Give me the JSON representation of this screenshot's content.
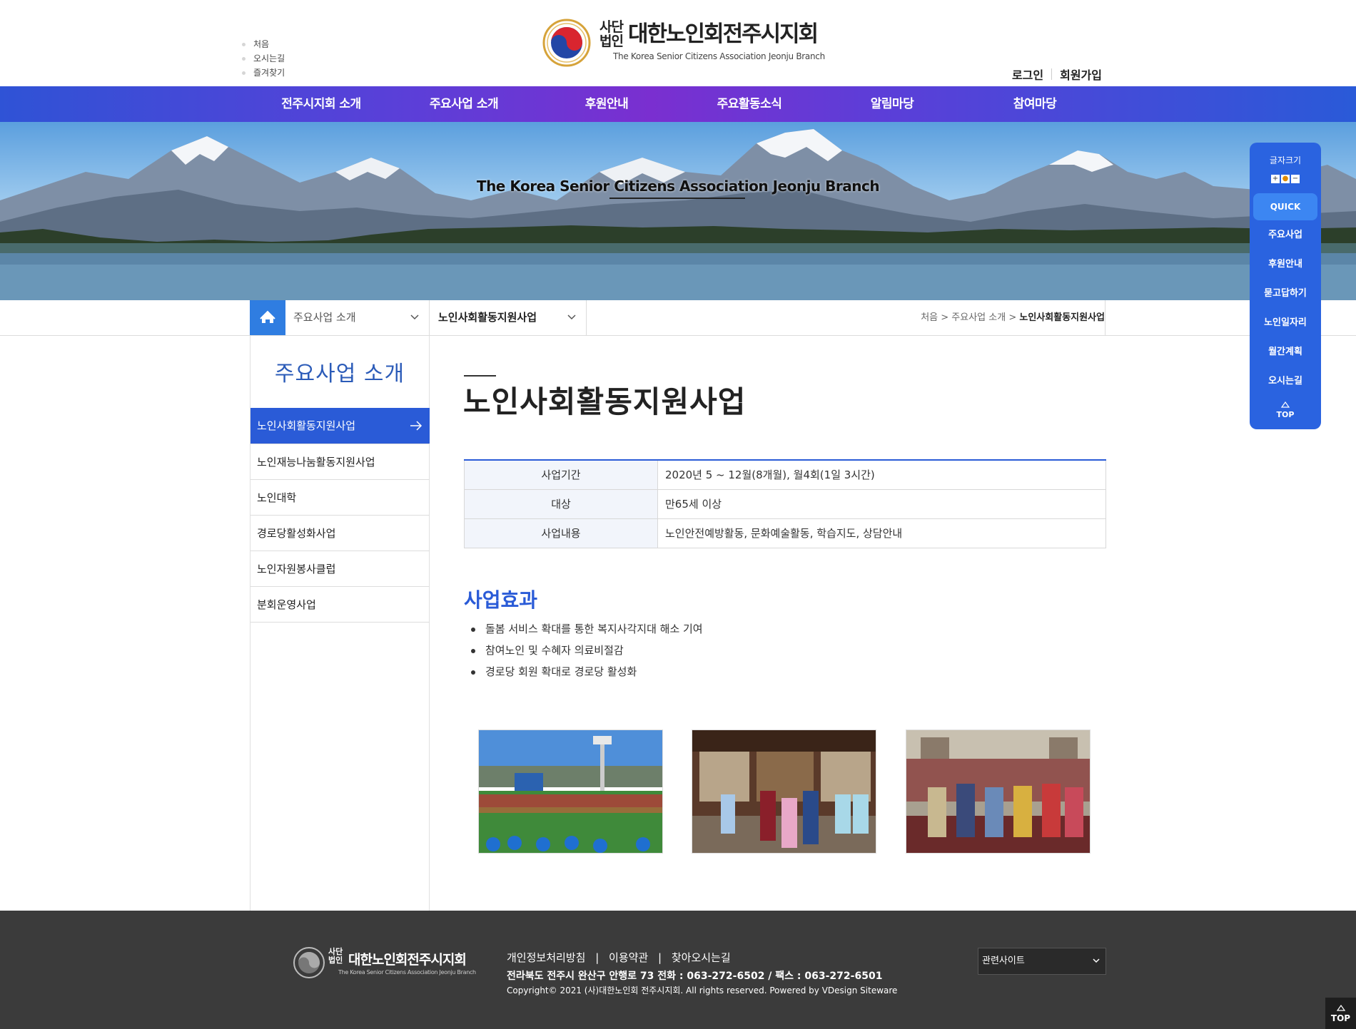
{
  "util_links": [
    "처음",
    "오시는길",
    "즐겨찾기"
  ],
  "logo": {
    "corp_line1": "사단",
    "corp_line2": "법인",
    "name": "대한노인회전주시지회",
    "english": "The Korea Senior Citizens Association Jeonju Branch"
  },
  "member": {
    "login": "로그인",
    "join": "회원가입"
  },
  "gnb": [
    "전주시지회 소개",
    "주요사업 소개",
    "후원안내",
    "주요활동소식",
    "알림마당",
    "참여마당"
  ],
  "visual": {
    "title": "The Korea Senior Citizens Association Jeonju Branch"
  },
  "location": {
    "dropdown1": "주요사업 소개",
    "dropdown2": "노인사회활동지원사업",
    "crumb_home": "처음",
    "crumb_sep": ">",
    "crumb_mid": "주요사업 소개",
    "crumb_current": "노인사회활동지원사업"
  },
  "side": {
    "title": "주요사업 소개",
    "items": [
      "노인사회활동지원사업",
      "노인재능나눔활동지원사업",
      "노인대학",
      "경로당활성화사업",
      "노인자원봉사클럽",
      "분회운영사업"
    ]
  },
  "page": {
    "title": "노인사회활동지원사업"
  },
  "info_table": [
    {
      "label": "사업기간",
      "value": "2020년 5 ~ 12월(8개월), 월4회(1일 3시간)"
    },
    {
      "label": "대상",
      "value": "만65세 이상"
    },
    {
      "label": "사업내용",
      "value": "노인안전예방활동, 문화예술활동, 학습지도, 상담안내"
    }
  ],
  "effects": {
    "title": "사업효과",
    "items": [
      "돌봄 서비스 확대를 통한 복지사각지대 해소 기여",
      "참여노인 및 수혜자 의료비절감",
      "경로당 회원 확대로 경로당 활성화"
    ]
  },
  "quick": {
    "font_size_label": "글자크기",
    "font_buttons": [
      "+",
      "●",
      "−"
    ],
    "head": "QUICK",
    "items": [
      "주요사업",
      "후원안내",
      "묻고답하기",
      "노인일자리",
      "월간계획",
      "오시는길"
    ],
    "top": "TOP"
  },
  "footer": {
    "links": [
      "개인정보처리방침",
      "이용약관",
      "찾아오시는길"
    ],
    "link_sep": "|",
    "address": "전라북도 전주시 완산구 안행로 73 전화 : 063-272-6502  /  팩스 : 063-272-6501",
    "copyright": "Copyright© 2021 (사)대한노인회 전주시지회. All rights reserved. Powered by VDesign Siteware",
    "related_select": "관련사이트",
    "top_button": "TOP"
  },
  "colors": {
    "primary": "#2a5bd7",
    "gnb_mid": "#7a2fd0",
    "footer_bg": "#3b3b3b",
    "quick_bg": "#2a63e0"
  }
}
